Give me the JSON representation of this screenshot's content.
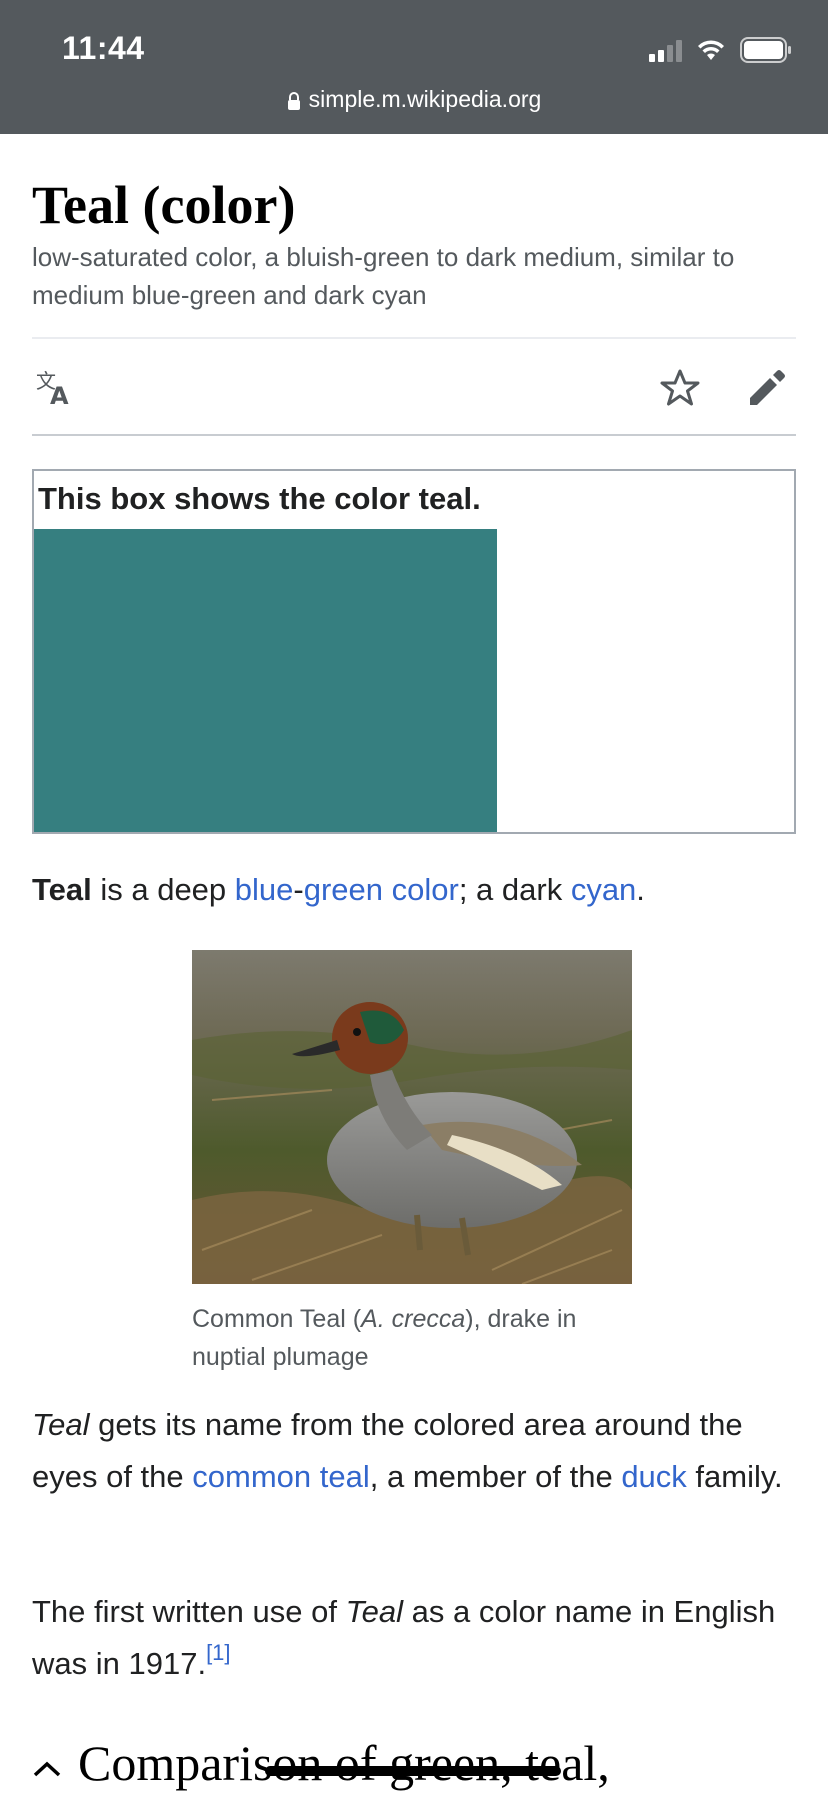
{
  "status_bar": {
    "time": "11:44"
  },
  "browser": {
    "url": "simple.m.wikipedia.org"
  },
  "article": {
    "title": "Teal (color)",
    "description": "low-saturated color, a bluish-green to dark medium, similar to medium blue-green and dark cyan",
    "actions": {
      "language_icon": "translate-icon",
      "watch_icon": "star-icon",
      "edit_icon": "pencil-icon"
    },
    "color_box": {
      "caption": "This box shows the color teal.",
      "swatch_color": "#367f80"
    },
    "intro": {
      "bold": "Teal",
      "t1": " is a deep ",
      "link_blue": "blue",
      "t2": "-",
      "link_green_color": "green color",
      "t3": "; a dark ",
      "link_cyan": "cyan",
      "t4": "."
    },
    "figure": {
      "caption_pre": "Common Teal (",
      "caption_italic": "A. crecca",
      "caption_post": "), drake in nuptial plumage"
    },
    "para2": {
      "italic": "Teal",
      "t1": " gets its name from the colored area around the eyes of the ",
      "link_common_teal": "common teal",
      "t2": ", a member of the ",
      "link_duck": "duck",
      "t3": " family."
    },
    "para3": {
      "t1": "The first written use of ",
      "italic": "Teal",
      "t2": " as a color name in English was in 1917.",
      "ref": "[1]"
    },
    "section_heading": "Comparison of green, teal,"
  },
  "colors": {
    "link": "#3366cc",
    "header_bg": "#54595d"
  }
}
